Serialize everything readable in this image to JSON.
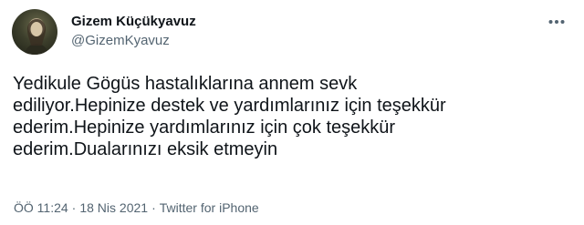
{
  "author": {
    "display_name": "Gizem Küçükyavuz",
    "handle": "@GizemKyavuz",
    "avatar_icon": "user-avatar"
  },
  "more_icon": "more-horizontal-icon",
  "tweet": {
    "text_lines": [
      "Yedikule Gögüs hastalıklarına annem sevk",
      "ediliyor.Hepinize destek ve yardımlarınız için teşekkür",
      "ederim.Hepinize yardımlarınız için çok teşekkür",
      "ederim.Dualarınızı eksik etmeyin"
    ]
  },
  "meta": {
    "time": "ÖÖ 11:24",
    "separator": "·",
    "date": "18 Nis 2021",
    "source": "Twitter for iPhone"
  },
  "colors": {
    "text": "#0f1419",
    "secondary": "#536471",
    "background": "#ffffff"
  }
}
